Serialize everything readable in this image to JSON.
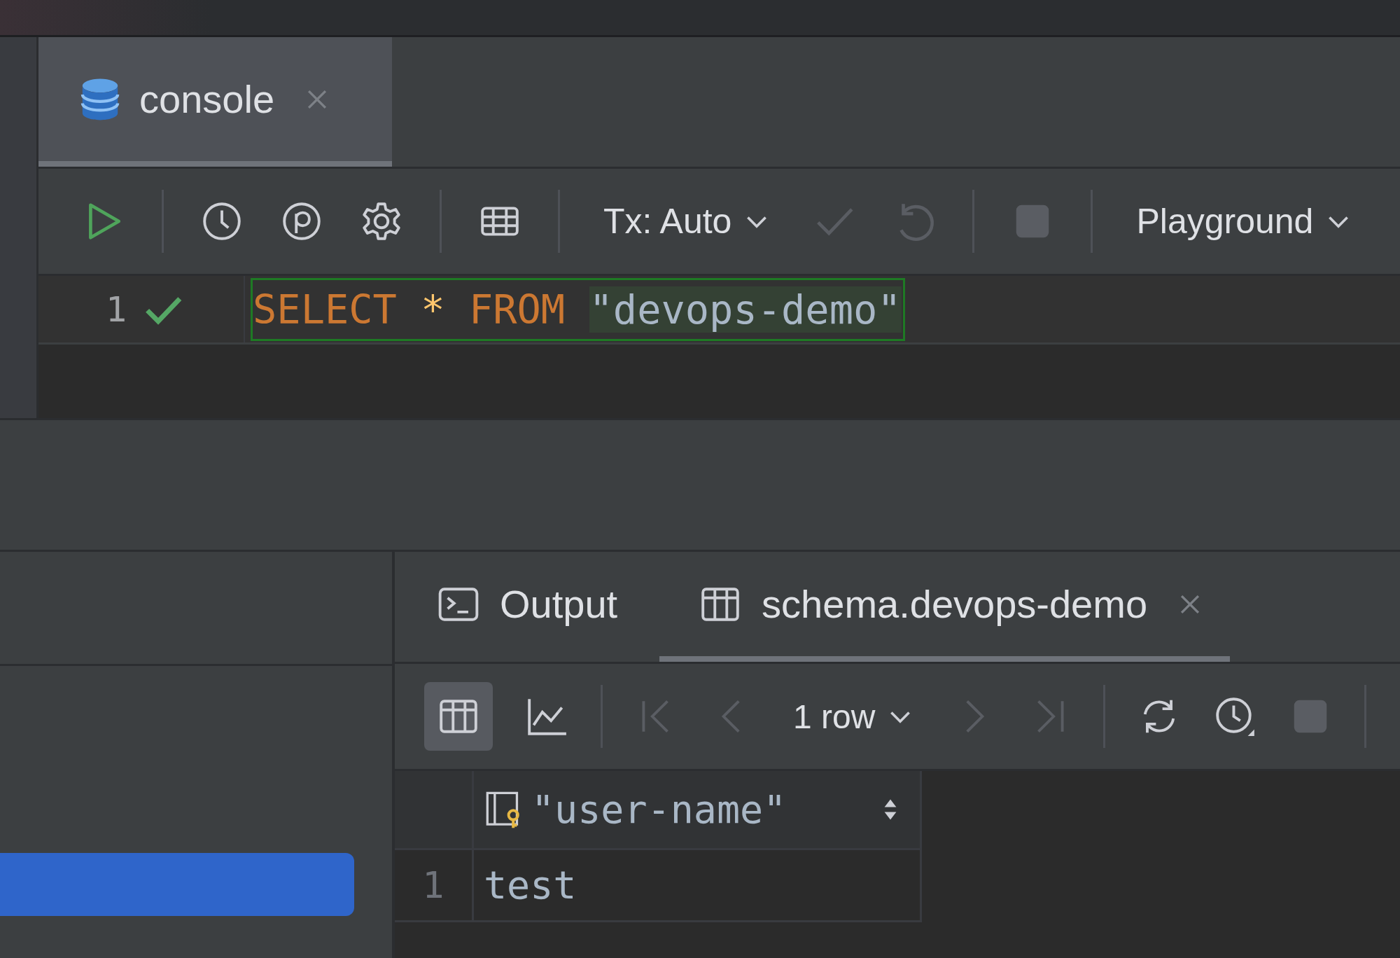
{
  "editor_tabs": [
    {
      "label": "console",
      "selected": true,
      "closable": true
    }
  ],
  "editor_toolbar": {
    "transaction_mode": "Tx: Auto",
    "schema": "Playground"
  },
  "editor": {
    "lines": [
      {
        "number": "1",
        "check_passed": true,
        "tokens": [
          {
            "text": "SELECT",
            "kind": "keyword"
          },
          {
            "text": "*",
            "kind": "operator"
          },
          {
            "text": "FROM",
            "kind": "keyword"
          },
          {
            "text": "\"devops-demo\"",
            "kind": "identifier"
          }
        ]
      }
    ]
  },
  "left_panel": {
    "rows": [
      {
        "selected": true
      }
    ]
  },
  "result_tabs": [
    {
      "label": "Output",
      "kind": "output",
      "selected": false,
      "closable": false
    },
    {
      "label": "schema.devops-demo",
      "kind": "table",
      "selected": true,
      "closable": true
    }
  ],
  "result_toolbar": {
    "row_count": "1 row"
  },
  "table": {
    "columns": [
      "\"user-name\""
    ],
    "rows": [
      {
        "number": "1",
        "cells": [
          "test"
        ]
      }
    ]
  }
}
